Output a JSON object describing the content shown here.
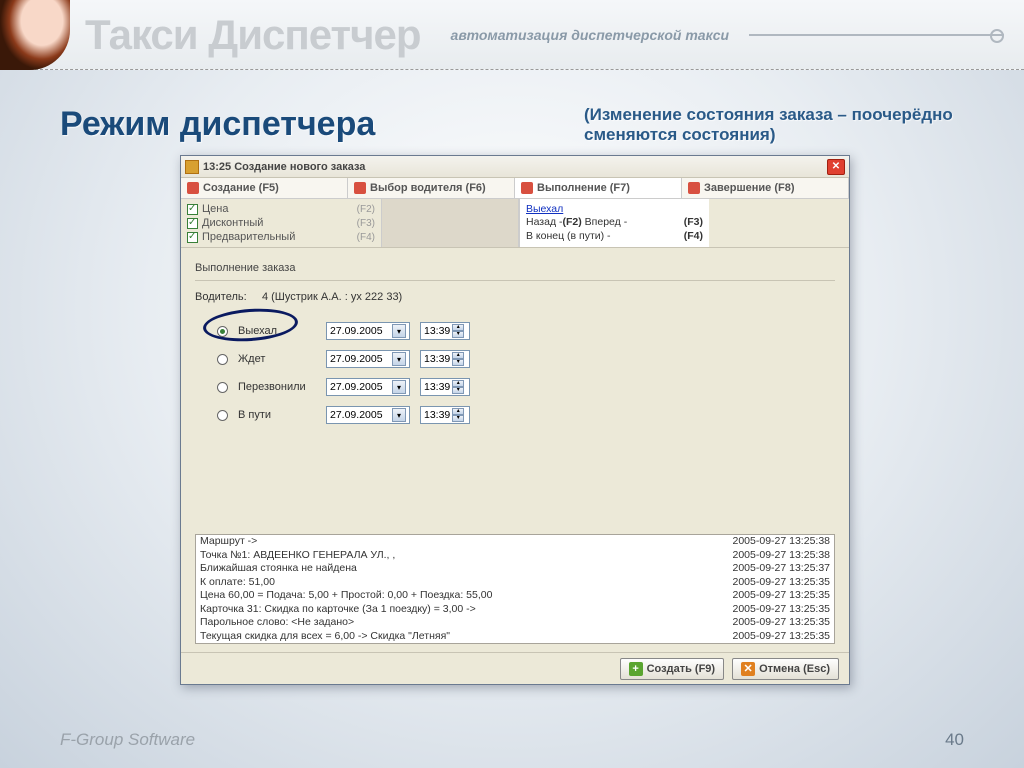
{
  "banner": {
    "brand": "Такси Диспетчер",
    "tagline": "автоматизация диспетчерской такси"
  },
  "page": {
    "title": "Режим диспетчера",
    "subtitle": "(Изменение состояния заказа – поочерёдно сменяются состояния)"
  },
  "window": {
    "title": "13:25 Создание нового заказа",
    "tabs": [
      {
        "label": "Создание (F5)"
      },
      {
        "label": "Выбор водителя (F6)"
      },
      {
        "label": "Выполнение (F7)"
      },
      {
        "label": "Завершение (F8)"
      }
    ],
    "checks": [
      {
        "label": "Цена",
        "key": "(F2)"
      },
      {
        "label": "Дисконтный",
        "key": "(F3)"
      },
      {
        "label": "Предварительный",
        "key": "(F4)"
      }
    ],
    "subtab": {
      "link": "Выехал",
      "r1a": "Назад -",
      "r1b": "(F2)",
      "r1c": "Вперед -",
      "r1d": "(F3)",
      "r2a": "В конец (в пути) -",
      "r2b": "(F4)"
    },
    "section_label": "Выполнение заказа",
    "driver_label": "Водитель:",
    "driver_value": "4 (Шустрик А.А. : ух 222 33)",
    "statuses": [
      {
        "label": "Выехал",
        "date": "27.09.2005",
        "time": "13:39",
        "selected": true
      },
      {
        "label": "Ждет",
        "date": "27.09.2005",
        "time": "13:39",
        "selected": false
      },
      {
        "label": "Перезвонили",
        "date": "27.09.2005",
        "time": "13:39",
        "selected": false
      },
      {
        "label": "В пути",
        "date": "27.09.2005",
        "time": "13:39",
        "selected": false
      }
    ],
    "log": [
      {
        "text": "Маршрут ->",
        "ts": "2005-09-27 13:25:38"
      },
      {
        "text": "Точка №1: АВДЕЕНКО ГЕНЕРАЛА УЛ., ,",
        "ts": "2005-09-27 13:25:38"
      },
      {
        "text": "Ближайшая стоянка не найдена",
        "ts": "2005-09-27 13:25:37"
      },
      {
        "text": "К оплате: 51,00",
        "ts": "2005-09-27 13:25:35"
      },
      {
        "text": "Цена 60,00 = Подача: 5,00 + Простой: 0,00 + Поездка: 55,00",
        "ts": "2005-09-27 13:25:35"
      },
      {
        "text": "Карточка 31: Скидка по карточке (За 1 поездку) = 3,00 ->",
        "ts": "2005-09-27 13:25:35"
      },
      {
        "text": "Парольное слово: <Не задано>",
        "ts": "2005-09-27 13:25:35"
      },
      {
        "text": "Текущая скидка для всех = 6,00 -> Скидка \"Летняя\"",
        "ts": "2005-09-27 13:25:35"
      }
    ],
    "buttons": {
      "create": "Создать (F9)",
      "cancel": "Отмена (Esc)"
    }
  },
  "footer": {
    "company": "F-Group Software",
    "page": "40"
  }
}
